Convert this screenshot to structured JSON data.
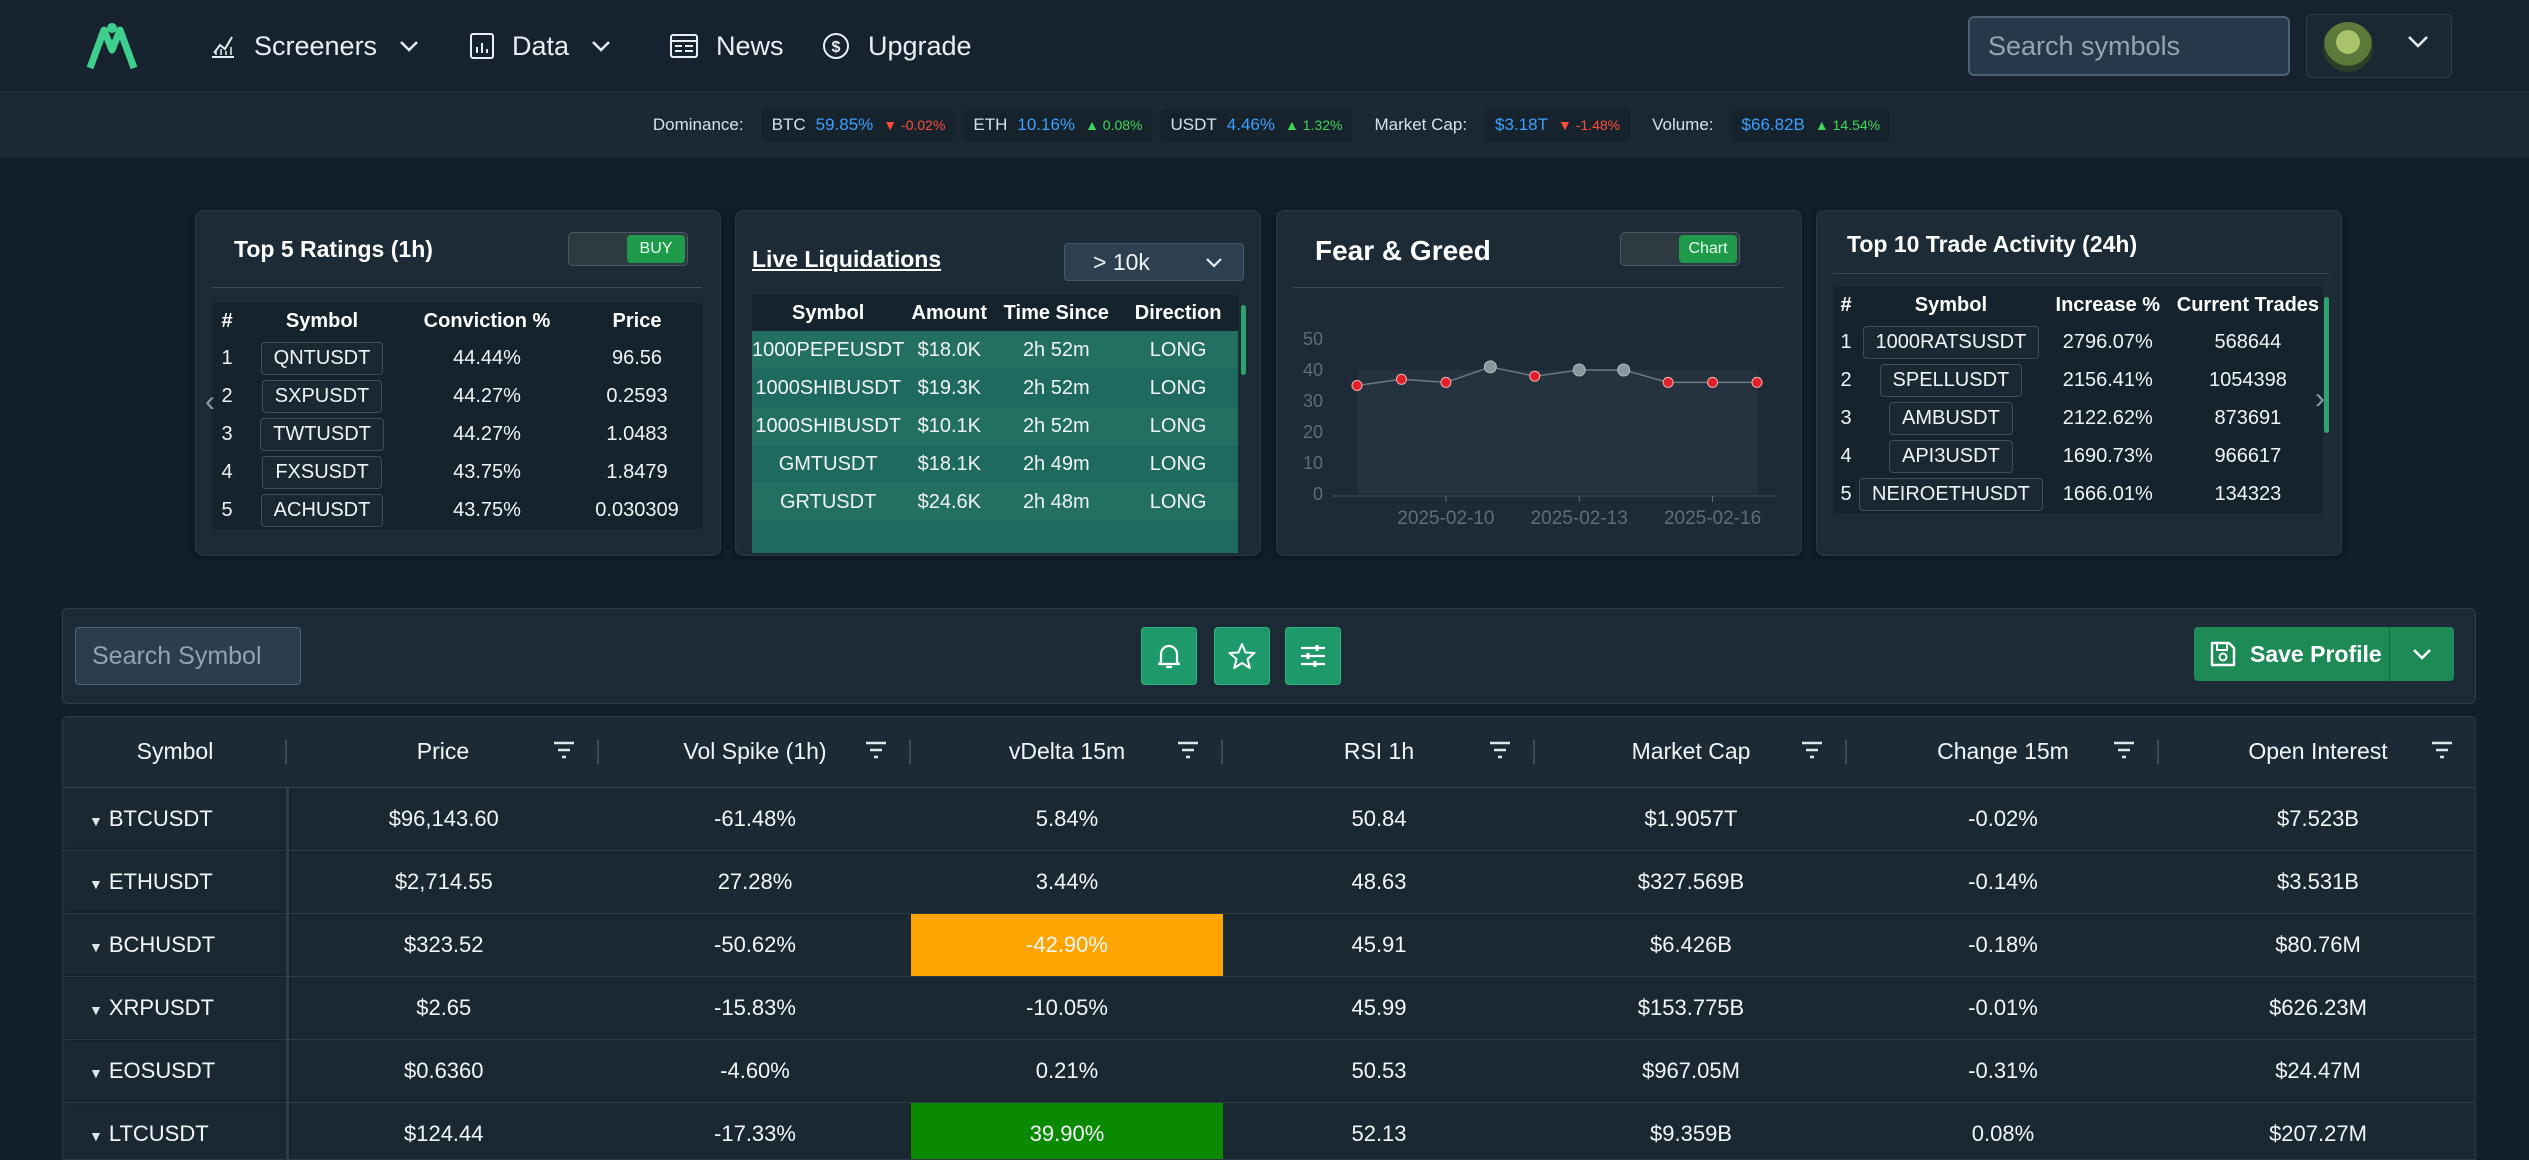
{
  "nav": {
    "items": [
      {
        "label": "Screeners",
        "icon": "chart-line-icon",
        "dropdown": true
      },
      {
        "label": "Data",
        "icon": "bar-chart-icon",
        "dropdown": true
      },
      {
        "label": "News",
        "icon": "newspaper-icon",
        "dropdown": false
      },
      {
        "label": "Upgrade",
        "icon": "dollar-circle-icon",
        "dropdown": false
      }
    ],
    "search_placeholder": "Search symbols"
  },
  "ticker": {
    "dominance_label": "Dominance:",
    "btc": {
      "label": "BTC",
      "value": "59.85%",
      "change": "▼ -0.02%"
    },
    "eth": {
      "label": "ETH",
      "value": "10.16%",
      "change": "▲ 0.08%"
    },
    "usdt": {
      "label": "USDT",
      "value": "4.46%",
      "change": "▲ 1.32%"
    },
    "market_cap_label": "Market Cap:",
    "market_cap": {
      "value": "$3.18T",
      "change": "▼ -1.48%"
    },
    "volume_label": "Volume:",
    "volume": {
      "value": "$66.82B",
      "change": "▲ 14.54%"
    }
  },
  "ratings": {
    "title": "Top 5 Ratings (1h)",
    "toggle": "BUY",
    "headers": [
      "#",
      "Symbol",
      "Conviction %",
      "Price"
    ],
    "rows": [
      [
        "1",
        "QNTUSDT",
        "44.44%",
        "96.56"
      ],
      [
        "2",
        "SXPUSDT",
        "44.27%",
        "0.2593"
      ],
      [
        "3",
        "TWTUSDT",
        "44.27%",
        "1.0483"
      ],
      [
        "4",
        "FXSUSDT",
        "43.75%",
        "1.8479"
      ],
      [
        "5",
        "ACHUSDT",
        "43.75%",
        "0.030309"
      ]
    ]
  },
  "liquidations": {
    "title": "Live Liquidations",
    "filter": "> 10k",
    "headers": [
      "Symbol",
      "Amount",
      "Time Since",
      "Direction"
    ],
    "rows": [
      [
        "1000PEPEUSDT",
        "$18.0K",
        "2h 52m",
        "LONG"
      ],
      [
        "1000SHIBUSDT",
        "$19.3K",
        "2h 52m",
        "LONG"
      ],
      [
        "1000SHIBUSDT",
        "$10.1K",
        "2h 52m",
        "LONG"
      ],
      [
        "GMTUSDT",
        "$18.1K",
        "2h 49m",
        "LONG"
      ],
      [
        "GRTUSDT",
        "$24.6K",
        "2h 48m",
        "LONG"
      ]
    ]
  },
  "fear_greed": {
    "title": "Fear & Greed",
    "toggle": "Chart"
  },
  "chart_data": {
    "type": "line",
    "title": "",
    "x": [
      "2025-02-08",
      "2025-02-09",
      "2025-02-10",
      "2025-02-11",
      "2025-02-12",
      "2025-02-13",
      "2025-02-14",
      "2025-02-15",
      "2025-02-16",
      "2025-02-17"
    ],
    "xticks": [
      "2025-02-10",
      "2025-02-13",
      "2025-02-16"
    ],
    "series": [
      {
        "values": [
          35,
          37,
          36,
          41,
          38,
          40,
          40,
          36,
          36,
          36
        ]
      }
    ],
    "point_status": [
      "red",
      "red",
      "red",
      "grey",
      "red",
      "grey",
      "grey",
      "red",
      "red",
      "red"
    ],
    "yticks": [
      0,
      10,
      20,
      30,
      40,
      50
    ],
    "ylim": [
      0,
      50
    ],
    "grid": false
  },
  "trade_activity": {
    "title": "Top 10 Trade Activity (24h)",
    "headers": [
      "#",
      "Symbol",
      "Increase %",
      "Current Trades"
    ],
    "rows": [
      [
        "1",
        "1000RATSUSDT",
        "2796.07%",
        "568644"
      ],
      [
        "2",
        "SPELLUSDT",
        "2156.41%",
        "1054398"
      ],
      [
        "3",
        "AMBUSDT",
        "2122.62%",
        "873691"
      ],
      [
        "4",
        "API3USDT",
        "1690.73%",
        "966617"
      ],
      [
        "5",
        "NEIROETHUSDT",
        "1666.01%",
        "134323"
      ]
    ]
  },
  "filterbar": {
    "search_placeholder": "Search Symbol",
    "save_label": "Save Profile"
  },
  "grid": {
    "headers": [
      "Symbol",
      "Price",
      "Vol Spike (1h)",
      "vDelta 15m",
      "RSI 1h",
      "Market Cap",
      "Change 15m",
      "Open Interest"
    ],
    "rows": [
      {
        "cells": [
          "BTCUSDT",
          "$96,143.60",
          "-61.48%",
          "5.84%",
          "50.84",
          "$1.9057T",
          "-0.02%",
          "$7.523B"
        ],
        "vdelta_color": ""
      },
      {
        "cells": [
          "ETHUSDT",
          "$2,714.55",
          "27.28%",
          "3.44%",
          "48.63",
          "$327.569B",
          "-0.14%",
          "$3.531B"
        ],
        "vdelta_color": ""
      },
      {
        "cells": [
          "BCHUSDT",
          "$323.52",
          "-50.62%",
          "-42.90%",
          "45.91",
          "$6.426B",
          "-0.18%",
          "$80.76M"
        ],
        "vdelta_color": "#ffa500"
      },
      {
        "cells": [
          "XRPUSDT",
          "$2.65",
          "-15.83%",
          "-10.05%",
          "45.99",
          "$153.775B",
          "-0.01%",
          "$626.23M"
        ],
        "vdelta_color": ""
      },
      {
        "cells": [
          "EOSUSDT",
          "$0.6360",
          "-4.60%",
          "0.21%",
          "50.53",
          "$967.05M",
          "-0.31%",
          "$24.47M"
        ],
        "vdelta_color": ""
      },
      {
        "cells": [
          "LTCUSDT",
          "$124.44",
          "-17.33%",
          "39.90%",
          "52.13",
          "$9.359B",
          "0.08%",
          "$207.27M"
        ],
        "vdelta_color": "#0a8a00"
      }
    ]
  }
}
